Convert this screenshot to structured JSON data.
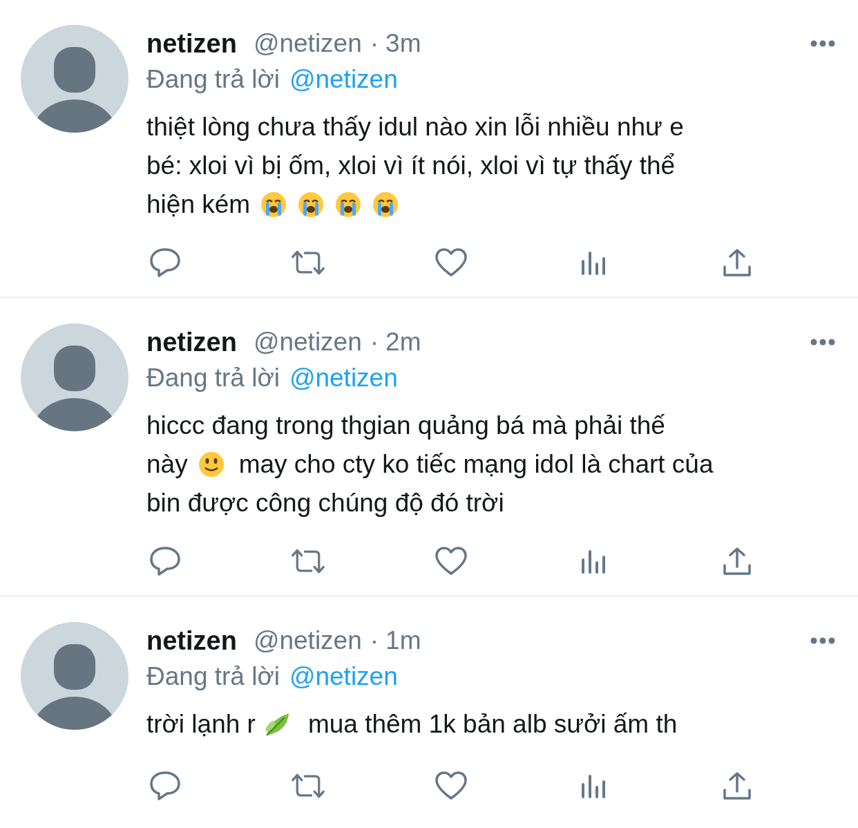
{
  "tweets": [
    {
      "name": "netizen",
      "handle": "@netizen",
      "separator": "·",
      "time": "3m",
      "reply_prefix": "Đang trả lời",
      "reply_to": "@netizen",
      "lines": [
        [
          {
            "kind": "text",
            "text": "thiệt lòng chưa thấy idul nào xin lỗi nhiều như e"
          }
        ],
        [
          {
            "kind": "text",
            "text": "bé: xloi vì bị ốm, xloi vì ít nói, xloi vì tự thấy thể"
          }
        ],
        [
          {
            "kind": "text",
            "text": "hiện kém"
          },
          {
            "kind": "sob"
          },
          {
            "kind": "sob"
          },
          {
            "kind": "sob"
          },
          {
            "kind": "sob"
          }
        ]
      ]
    },
    {
      "name": "netizen",
      "handle": "@netizen",
      "separator": "·",
      "time": "2m",
      "reply_prefix": "Đang trả lời",
      "reply_to": "@netizen",
      "lines": [
        [
          {
            "kind": "text",
            "text": "hiccc đang trong thgian quảng bá mà phải thế"
          }
        ],
        [
          {
            "kind": "text",
            "text": "này"
          },
          {
            "kind": "smile"
          },
          {
            "kind": "text",
            "text": "may cho cty ko tiếc mạng idol là chart của"
          }
        ],
        [
          {
            "kind": "text",
            "text": "bin được công chúng độ đó trời"
          }
        ]
      ]
    },
    {
      "name": "netizen",
      "handle": "@netizen",
      "separator": "·",
      "time": "1m",
      "reply_prefix": "Đang trả lời",
      "reply_to": "@netizen",
      "lines": [
        [
          {
            "kind": "text",
            "text": "trời lạnh r"
          },
          {
            "kind": "leaf"
          },
          {
            "kind": "text",
            "text": "mua thêm 1k bản alb sưởi ấm th"
          }
        ]
      ]
    }
  ]
}
